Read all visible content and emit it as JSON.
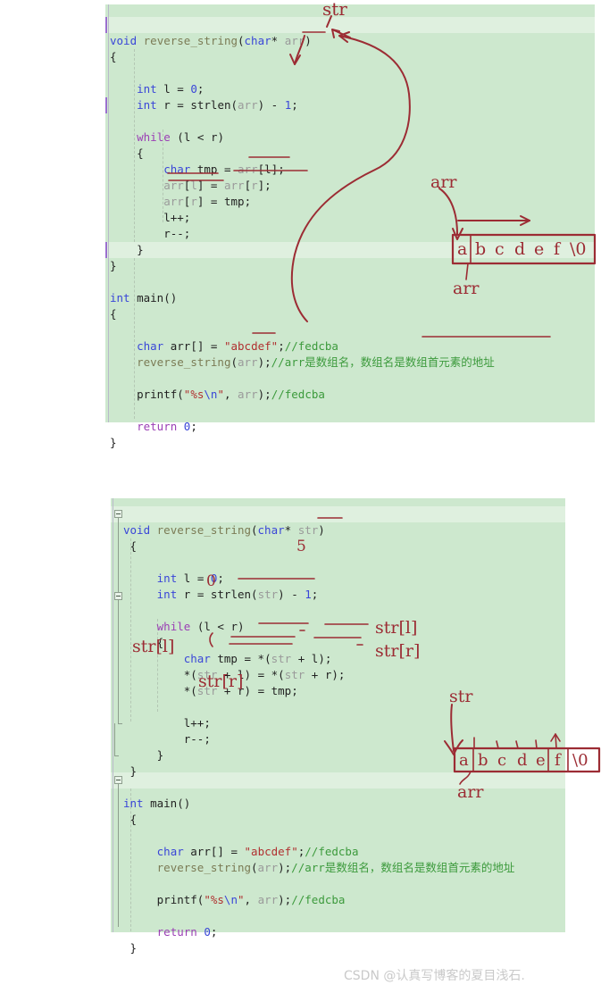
{
  "page": {
    "watermark": "CSDN @认真写博客的夏目浅石."
  },
  "block1": {
    "name": "code-block-array-version",
    "lines": [
      {
        "id": "b1l1",
        "text": "void reverse_string(char* arr)"
      },
      {
        "id": "b1l2",
        "text": "{"
      },
      {
        "id": "b1l3",
        "text": ""
      },
      {
        "id": "b1l4",
        "text": "    int l = 0;"
      },
      {
        "id": "b1l5",
        "text": "    int r = strlen(arr) - 1;"
      },
      {
        "id": "b1l6",
        "text": ""
      },
      {
        "id": "b1l7",
        "text": "    while (l < r)"
      },
      {
        "id": "b1l8",
        "text": "    {"
      },
      {
        "id": "b1l9",
        "text": "        char tmp = arr[l];"
      },
      {
        "id": "b1l10",
        "text": "        arr[l] = arr[r];"
      },
      {
        "id": "b1l11",
        "text": "        arr[r] = tmp;"
      },
      {
        "id": "b1l12",
        "text": "        l++;"
      },
      {
        "id": "b1l13",
        "text": "        r--;"
      },
      {
        "id": "b1l14",
        "text": "    }"
      },
      {
        "id": "b1l15",
        "text": "}"
      },
      {
        "id": "b1l16",
        "text": ""
      },
      {
        "id": "b1l17",
        "text": "int main()"
      },
      {
        "id": "b1l18",
        "text": "{"
      },
      {
        "id": "b1l19",
        "text": ""
      },
      {
        "id": "b1l20",
        "text": "    char arr[] = \"abcdef\";//fedcba"
      },
      {
        "id": "b1l21",
        "text": "    reverse_string(arr);//arr是数组名，数组名是数组首元素的地址"
      },
      {
        "id": "b1l22",
        "text": ""
      },
      {
        "id": "b1l23",
        "text": "    printf(\"%s\\n\", arr);//fedcba"
      },
      {
        "id": "b1l24",
        "text": ""
      },
      {
        "id": "b1l25",
        "text": "    return 0;"
      },
      {
        "id": "b1l26",
        "text": "}"
      }
    ]
  },
  "block2": {
    "name": "code-block-pointer-version",
    "lines": [
      {
        "id": "b2l1",
        "text": "void reverse_string(char* str)"
      },
      {
        "id": "b2l2",
        "text": " {"
      },
      {
        "id": "b2l3",
        "text": ""
      },
      {
        "id": "b2l4",
        "text": "     int l = 0;"
      },
      {
        "id": "b2l5",
        "text": "     int r = strlen(str) - 1;"
      },
      {
        "id": "b2l6",
        "text": ""
      },
      {
        "id": "b2l7",
        "text": "     while (l < r)"
      },
      {
        "id": "b2l8",
        "text": "     {"
      },
      {
        "id": "b2l9",
        "text": "         char tmp = *(str + l);"
      },
      {
        "id": "b2l10",
        "text": "         *(str + l) = *(str + r);"
      },
      {
        "id": "b2l11",
        "text": "         *(str + r) = tmp;"
      },
      {
        "id": "b2l12",
        "text": ""
      },
      {
        "id": "b2l13",
        "text": "         l++;"
      },
      {
        "id": "b2l14",
        "text": "         r--;"
      },
      {
        "id": "b2l15",
        "text": "     }"
      },
      {
        "id": "b2l16",
        "text": " }"
      },
      {
        "id": "b2l17",
        "text": ""
      },
      {
        "id": "b2l18",
        "text": "int main()"
      },
      {
        "id": "b2l19",
        "text": " {"
      },
      {
        "id": "b2l20",
        "text": ""
      },
      {
        "id": "b2l21",
        "text": "     char arr[] = \"abcdef\";//fedcba"
      },
      {
        "id": "b2l22",
        "text": "     reverse_string(arr);//arr是数组名，数组名是数组首元素的地址"
      },
      {
        "id": "b2l23",
        "text": ""
      },
      {
        "id": "b2l24",
        "text": "     printf(\"%s\\n\", arr);//fedcba"
      },
      {
        "id": "b2l25",
        "text": ""
      },
      {
        "id": "b2l26",
        "text": "     return 0;"
      },
      {
        "id": "b2l27",
        "text": " }"
      }
    ]
  },
  "annotations": {
    "ink_color": "#9c2c34",
    "block1": {
      "str_label_top": "str",
      "arr_label_above_box": "arr",
      "arr_label_below_box": "arr"
    },
    "block2": {
      "five_above_strlen": "5",
      "zero_below_l": "0",
      "str_l_left": "str[l]",
      "str_l_right": "str[l]",
      "str_r_right": "str[r]",
      "str_r_below": "str[r]",
      "str_label_box": "str",
      "arr_label_below_box": "arr"
    }
  },
  "array_diagram_1": {
    "name": "array-memory-diagram-arr",
    "cells": [
      "a",
      "b",
      "c",
      "d",
      "e",
      "f",
      "\\0"
    ],
    "pointer_label": "arr",
    "base_label": "arr"
  },
  "array_diagram_2": {
    "name": "array-memory-diagram-str",
    "cells": [
      "a",
      "b",
      "c",
      "d",
      "e",
      "f",
      "\\0"
    ],
    "pointer_label": "str",
    "base_label": "arr"
  }
}
